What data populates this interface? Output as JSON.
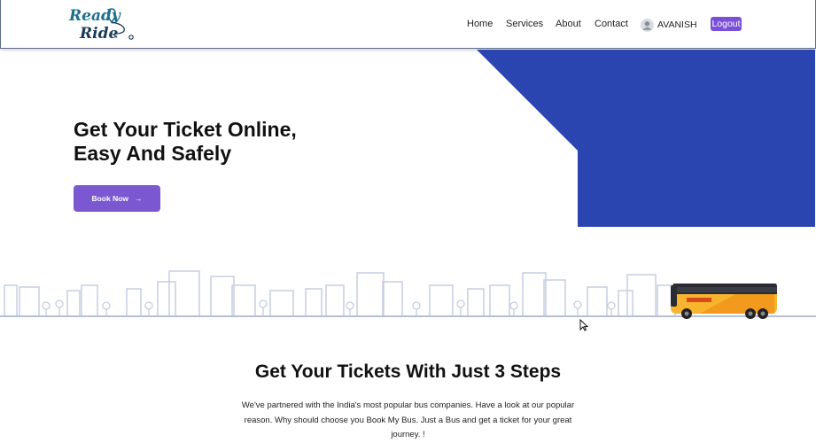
{
  "brand": {
    "logo_line1": "Ready",
    "logo_line2": "Ride"
  },
  "nav": {
    "links": [
      {
        "label": "Home"
      },
      {
        "label": "Services"
      },
      {
        "label": "About"
      },
      {
        "label": "Contact"
      }
    ],
    "user_name": "AVANISH",
    "logout_label": "Logout"
  },
  "hero": {
    "title_line1": "Get Your Ticket Online,",
    "title_line2": "Easy And Safely",
    "cta_label": "Book Now",
    "cta_arrow": "→"
  },
  "steps": {
    "title": "Get Your Tickets With Just 3 Steps",
    "description": "We've partnered with the India's most popular bus companies. Have a look at our popular reason. Why should choose you Book My Bus. Just a Bus and get a ticket for your great journey. !"
  },
  "colors": {
    "accent": "#7b4fd6",
    "hero_blue": "#2a45b0",
    "logo_blue": "#1d6f8e",
    "skyline": "#c5cde0",
    "bus_yellow": "#f7b42c"
  },
  "icons": [
    "logo-pin-icon",
    "user-avatar-icon",
    "arrow-right-icon",
    "mouse-cursor-icon"
  ]
}
